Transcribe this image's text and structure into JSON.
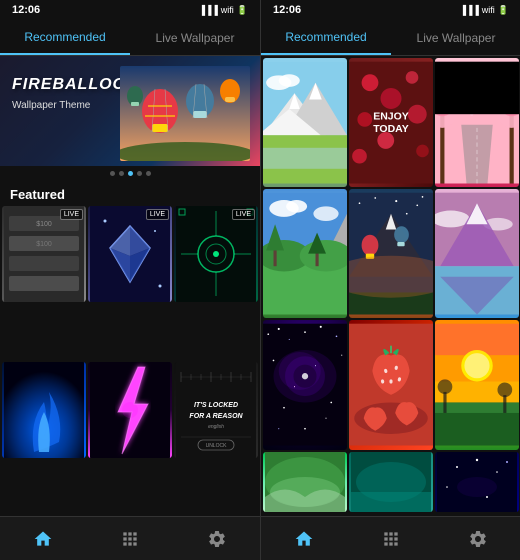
{
  "left_screen": {
    "status": {
      "time": "12:06"
    },
    "tabs": [
      {
        "label": "Recommended",
        "active": true
      },
      {
        "label": "Live Wallpaper",
        "active": false
      }
    ],
    "hero": {
      "title": "FIREBALLOON",
      "subtitle": "Wallpaper Theme"
    },
    "dots": [
      false,
      false,
      true,
      false,
      false
    ],
    "featured_label": "Featured",
    "wallpapers": [
      {
        "theme": "money",
        "live": true
      },
      {
        "theme": "diamond",
        "live": true
      },
      {
        "theme": "tech",
        "live": true
      },
      {
        "theme": "fire",
        "live": false
      },
      {
        "theme": "lightning",
        "live": false
      },
      {
        "theme": "locked",
        "live": false
      }
    ],
    "nav": {
      "home": "home",
      "apps": "apps",
      "settings": "settings"
    }
  },
  "right_screen": {
    "status": {
      "time": "12:06"
    },
    "tabs": [
      {
        "label": "Recommended",
        "active": true
      },
      {
        "label": "Live Wallpaper",
        "active": false
      }
    ],
    "wallpapers": [
      {
        "theme": "mountains"
      },
      {
        "theme": "enjoy",
        "text": "ENJOY\nTODAY"
      },
      {
        "theme": "cherry"
      },
      {
        "theme": "landscape"
      },
      {
        "theme": "balloons-sky"
      },
      {
        "theme": "mountain2"
      },
      {
        "theme": "galaxy"
      },
      {
        "theme": "strawberry"
      },
      {
        "theme": "sunset"
      },
      {
        "theme": "green"
      },
      {
        "theme": "teal"
      },
      {
        "theme": "space2"
      }
    ],
    "nav": {
      "home": "home",
      "apps": "apps",
      "settings": "settings"
    }
  }
}
